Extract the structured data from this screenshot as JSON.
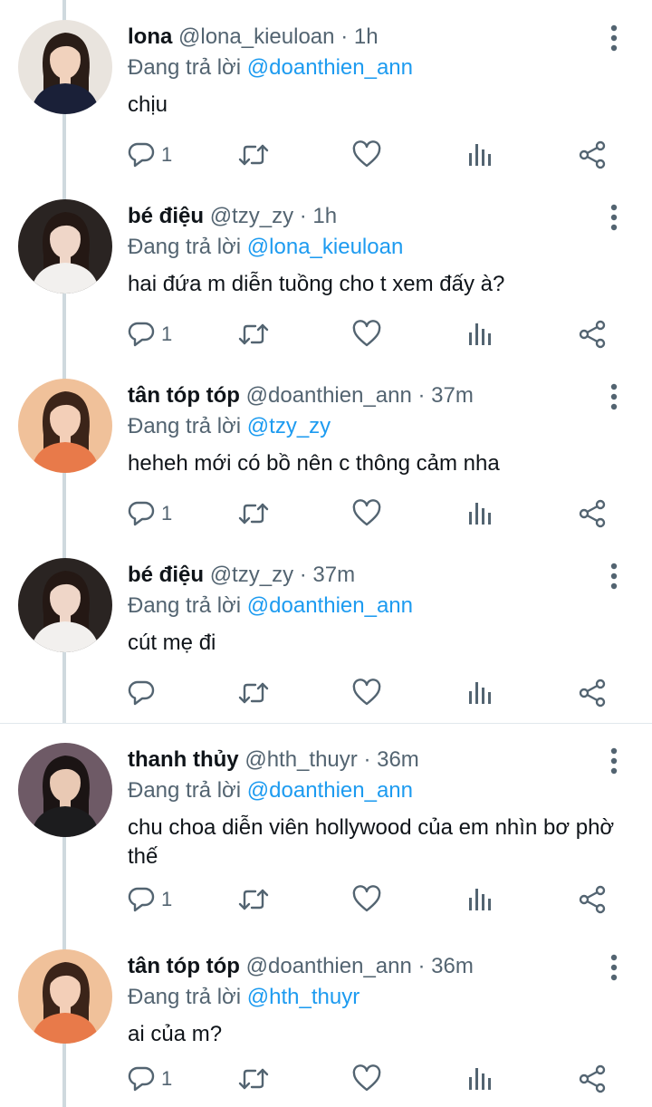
{
  "tweets": [
    {
      "name": "lona",
      "handle": "@lona_kieuloan",
      "time": "1h",
      "reply_prefix": "Đang trả lời",
      "reply_to": "@doanthien_ann",
      "text": "chịu",
      "reply_count": "1",
      "avatar": {
        "bg": "#e9e4de",
        "skin": "#f1d2bd",
        "hair": "#2a1d17",
        "cloth": "#1a2038"
      }
    },
    {
      "name": "bé điệu",
      "handle": "@tzy_zy",
      "time": "1h",
      "reply_prefix": "Đang trả lời",
      "reply_to": "@lona_kieuloan",
      "text": "hai đứa m diễn tuồng cho t xem đấy à?",
      "reply_count": "1",
      "avatar": {
        "bg": "#2a2422",
        "skin": "#efd6c8",
        "hair": "#241814",
        "cloth": "#f2f0ee"
      }
    },
    {
      "name": "tân tóp tóp",
      "handle": "@doanthien_ann",
      "time": "37m",
      "reply_prefix": "Đang trả lời",
      "reply_to": "@tzy_zy",
      "text": "heheh mới có bồ nên c thông cảm nha",
      "reply_count": "1",
      "avatar": {
        "bg": "#f0c19a",
        "skin": "#f3cfb8",
        "hair": "#3b2419",
        "cloth": "#e87a4a"
      }
    },
    {
      "name": "bé điệu",
      "handle": "@tzy_zy",
      "time": "37m",
      "reply_prefix": "Đang trả lời",
      "reply_to": "@doanthien_ann",
      "text": "cút mẹ đi",
      "reply_count": "",
      "avatar": {
        "bg": "#2a2422",
        "skin": "#efd6c8",
        "hair": "#241814",
        "cloth": "#f2f0ee"
      }
    },
    {
      "name": "thanh thủy",
      "handle": "@hth_thuyr",
      "time": "36m",
      "reply_prefix": "Đang trả lời",
      "reply_to": "@doanthien_ann",
      "text": "chu choa diễn viên hollywood của em nhìn bơ phờ thế",
      "reply_count": "1",
      "avatar": {
        "bg": "#6e5a66",
        "skin": "#e9c9b4",
        "hair": "#1b1414",
        "cloth": "#1c1c1e"
      }
    },
    {
      "name": "tân tóp tóp",
      "handle": "@doanthien_ann",
      "time": "36m",
      "reply_prefix": "Đang trả lời",
      "reply_to": "@hth_thuyr",
      "text": "ai của m?",
      "reply_count": "1",
      "avatar": {
        "bg": "#f0c19a",
        "skin": "#f3cfb8",
        "hair": "#3b2419",
        "cloth": "#e87a4a"
      }
    }
  ],
  "icons": {
    "reply": "reply-icon",
    "retweet": "retweet-icon",
    "like": "heart-icon",
    "stats": "stats-icon",
    "share": "share-icon",
    "more": "more-vertical-icon"
  },
  "colors": {
    "secondary": "#536471",
    "link": "#1d9bf0",
    "icon": "#536471",
    "thread": "#cfd9de"
  }
}
